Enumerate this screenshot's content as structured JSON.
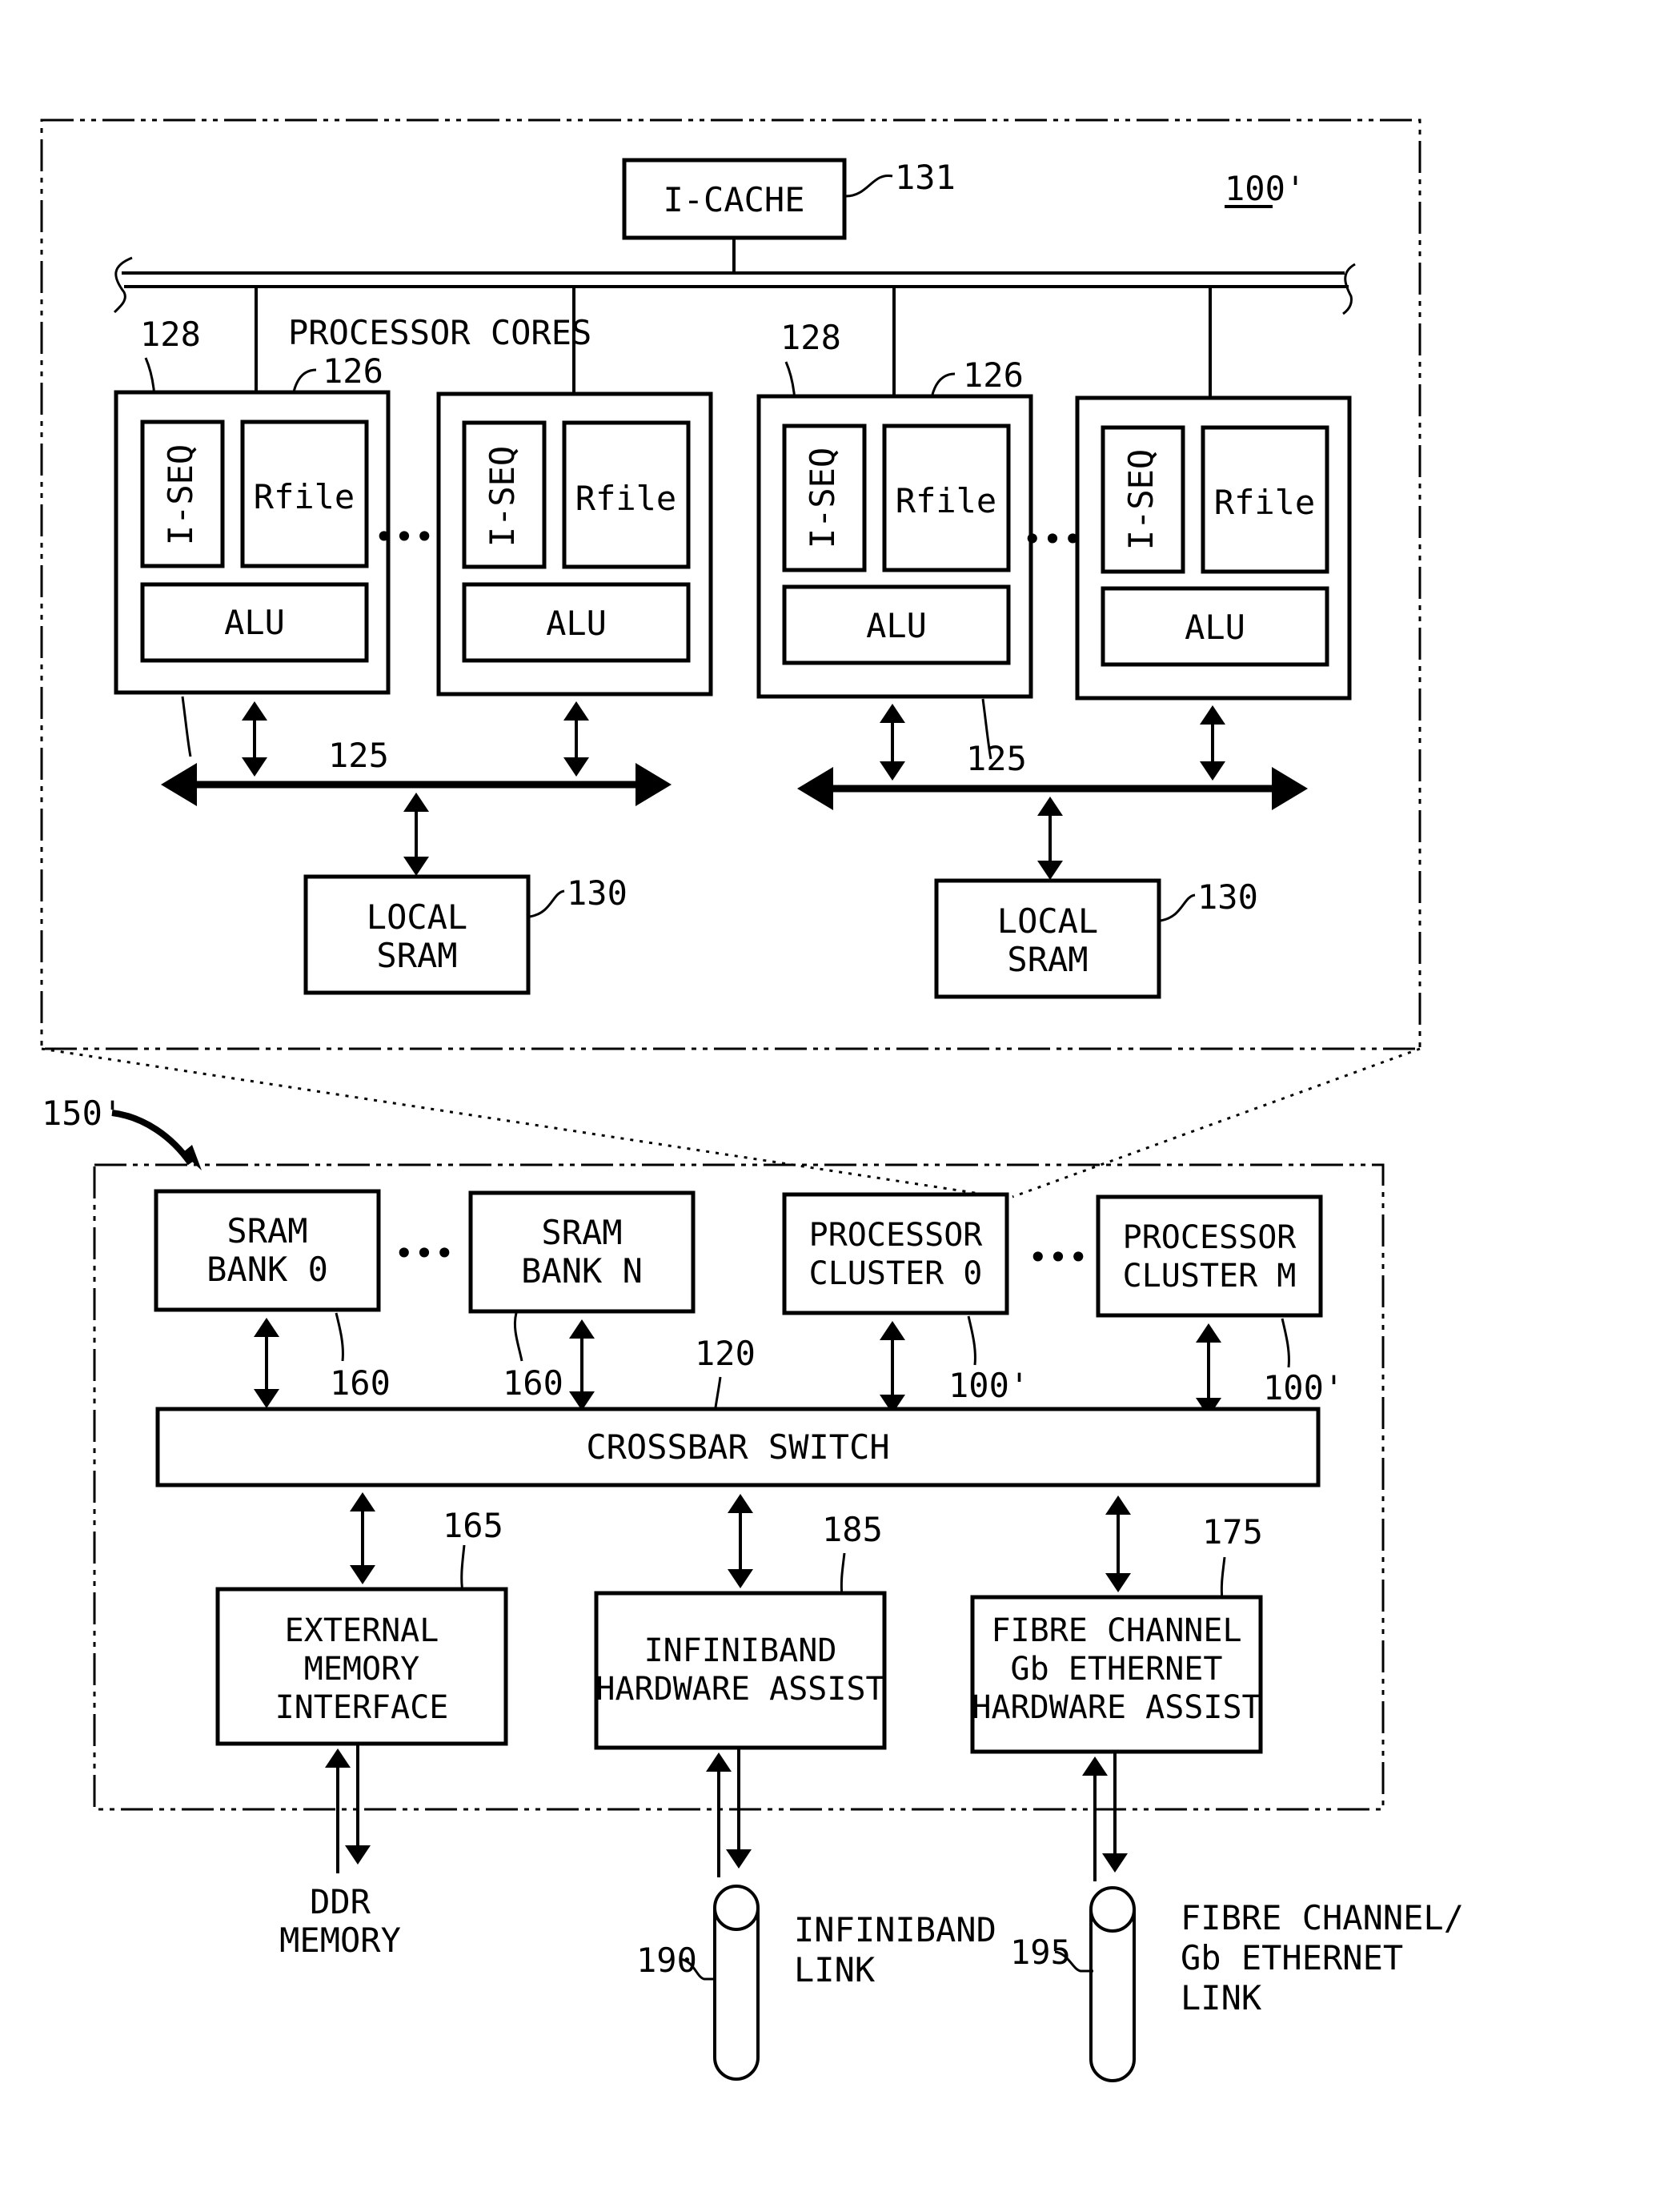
{
  "figure": {
    "cluster_detail": {
      "ref": "100'",
      "icache": {
        "label": "I-CACHE",
        "ref": "131"
      },
      "processor_cores_label": "PROCESSOR CORES",
      "ellipsis": "•••",
      "groups": [
        {
          "iseq_ref": "128",
          "rfile_ref": "126",
          "bus_ref": "125",
          "cores": [
            {
              "iseq": "I-SEQ",
              "rfile": "Rfile",
              "alu": "ALU"
            },
            {
              "iseq": "I-SEQ",
              "rfile": "Rfile",
              "alu": "ALU"
            }
          ],
          "local_sram": {
            "line1": "LOCAL",
            "line2": "SRAM",
            "ref": "130"
          }
        },
        {
          "iseq_ref": "128",
          "rfile_ref": "126",
          "bus_ref": "125",
          "cores": [
            {
              "iseq": "I-SEQ",
              "rfile": "Rfile",
              "alu": "ALU"
            },
            {
              "iseq": "I-SEQ",
              "rfile": "Rfile",
              "alu": "ALU"
            }
          ],
          "local_sram": {
            "line1": "LOCAL",
            "line2": "SRAM",
            "ref": "130"
          }
        }
      ]
    },
    "system": {
      "ref": "150'",
      "ellipsis": "•••",
      "sram_banks": [
        {
          "line1": "SRAM",
          "line2": "BANK 0",
          "ref": "160"
        },
        {
          "line1": "SRAM",
          "line2": "BANK N",
          "ref": "160"
        }
      ],
      "processor_clusters": [
        {
          "line1": "PROCESSOR",
          "line2": "CLUSTER 0",
          "ref": "100'"
        },
        {
          "line1": "PROCESSOR",
          "line2": "CLUSTER M",
          "ref": "100'"
        }
      ],
      "crossbar": {
        "label": "CROSSBAR SWITCH",
        "ref": "120"
      },
      "interfaces": [
        {
          "lines": [
            "EXTERNAL",
            "MEMORY",
            "INTERFACE"
          ],
          "ref": "165"
        },
        {
          "lines": [
            "INFINIBAND",
            "HARDWARE ASSIST"
          ],
          "ref": "185"
        },
        {
          "lines": [
            "FIBRE CHANNEL",
            "Gb ETHERNET",
            "HARDWARE ASSIST"
          ],
          "ref": "175"
        }
      ]
    },
    "external": {
      "ddr": {
        "line1": "DDR",
        "line2": "MEMORY"
      },
      "infiniband_link": {
        "line1": "INFINIBAND",
        "line2": "LINK",
        "ref": "190"
      },
      "fc_link": {
        "line1": "FIBRE CHANNEL/",
        "line2": "Gb ETHERNET",
        "line3": "LINK",
        "ref": "195"
      }
    }
  }
}
